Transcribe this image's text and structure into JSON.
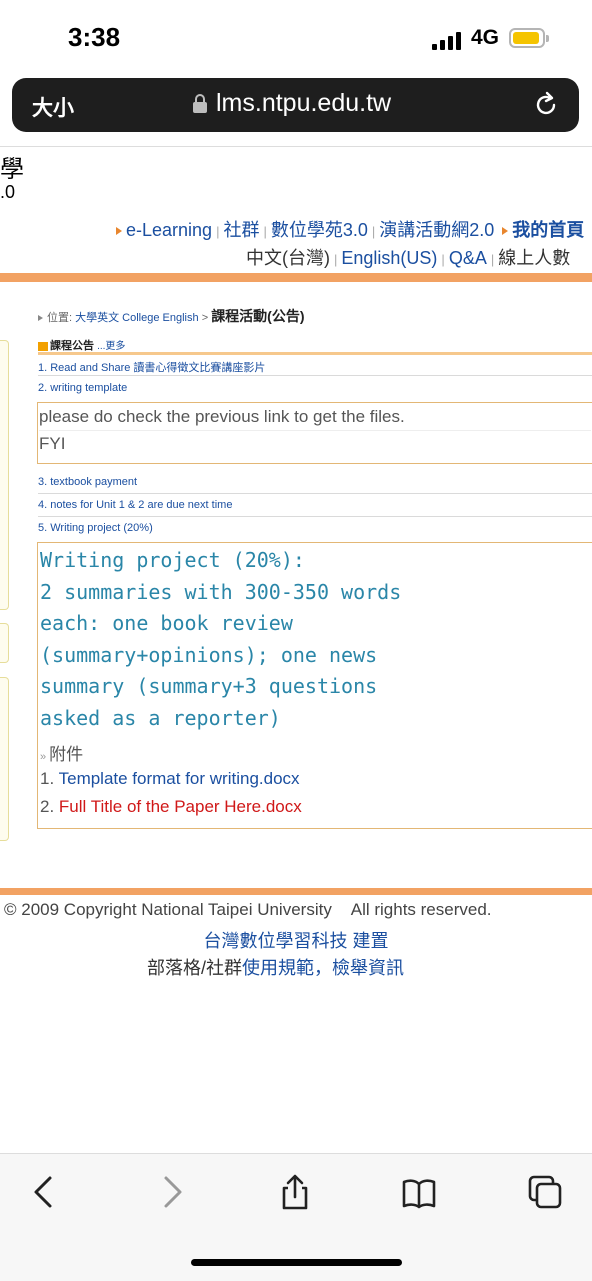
{
  "status_bar": {
    "time": "3:38",
    "network": "4G"
  },
  "address_bar": {
    "text_size_label": "大小",
    "host": "lms.ntpu.edu.tw"
  },
  "header": {
    "logo_char": "學",
    "logo_version": ".0",
    "nav_primary": [
      {
        "label": "e-Learning"
      },
      {
        "label": "社群"
      },
      {
        "label": "數位學苑3.0"
      },
      {
        "label": "演講活動網2.0"
      },
      {
        "label": "我的首頁"
      }
    ],
    "nav_secondary": [
      {
        "label": "中文(台灣)"
      },
      {
        "label": "English(US)"
      },
      {
        "label": "Q&A"
      },
      {
        "label": "線上人數"
      }
    ]
  },
  "breadcrumb": {
    "prefix": "位置:",
    "course": "大學英文 College English",
    "arrow": ">",
    "current": "課程活動(公告)"
  },
  "announcements": {
    "title": "課程公告",
    "more": "...更多",
    "items": [
      {
        "label": "1. Read and Share 讀書心得徵文比賽講座影片"
      },
      {
        "label": "2. writing template"
      },
      {
        "label": "3. textbook payment"
      },
      {
        "label": "4. notes for Unit 1 & 2 are due next time"
      },
      {
        "label": "5. Writing project (20%)"
      }
    ],
    "detail_2": {
      "line1": "please do check the previous link to get the files.",
      "line2": "FYI"
    },
    "detail_5": {
      "text": "Writing project (20%):\n2 summaries with 300-350 words\neach: one book review\n(summary+opinions); one news\nsummary (summary+3 questions\nasked as a reporter)",
      "attachments_label": "附件",
      "attachments": [
        {
          "num": "1.",
          "name": "Template format for writing.docx"
        },
        {
          "num": "2.",
          "name": "Full Title of the Paper Here.docx"
        }
      ]
    }
  },
  "footer": {
    "copyright": "© 2009 Copyright National Taipei University",
    "rights": "All rights reserved.",
    "built_by_link": "台灣數位學習科技",
    "built_by_suffix": "建置",
    "policy_prefix": "部落格/社群",
    "policy_link": "使用規範",
    "policy_sep": "，",
    "report_link": "檢舉資訊"
  },
  "colors": {
    "accent_orange": "#f2a263",
    "link_blue": "#1b4fa0",
    "project_teal": "#2a86a8",
    "attachment_red": "#d01818"
  }
}
